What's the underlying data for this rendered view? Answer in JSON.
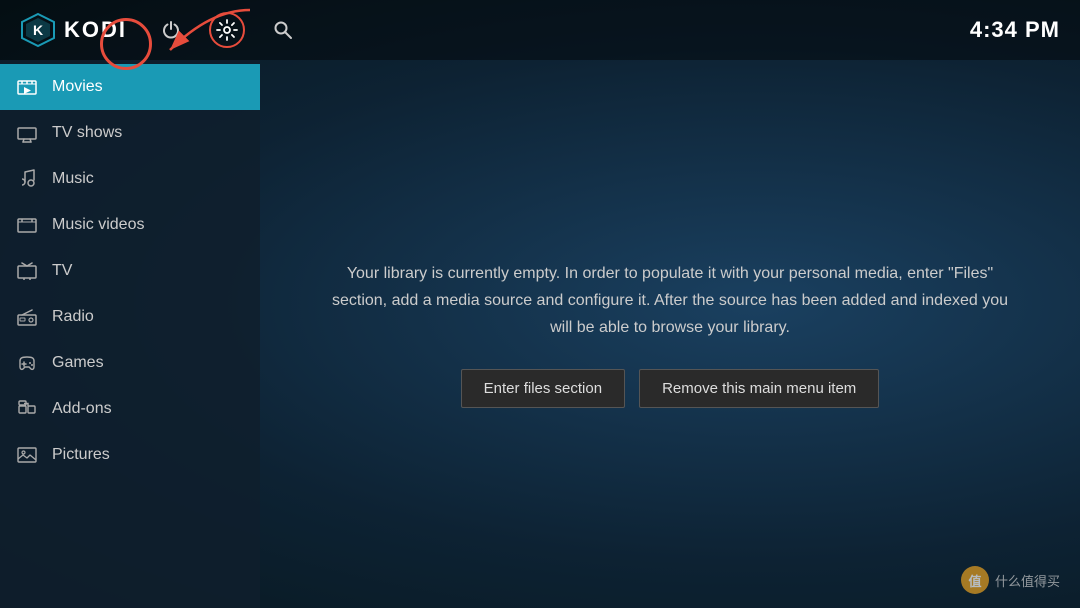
{
  "app": {
    "title": "KODI",
    "time": "4:34 PM"
  },
  "topbar": {
    "power_icon": "⏻",
    "settings_icon": "⚙",
    "search_icon": "🔍"
  },
  "sidebar": {
    "items": [
      {
        "id": "movies",
        "label": "Movies",
        "icon": "🎬",
        "active": true
      },
      {
        "id": "tvshows",
        "label": "TV shows",
        "icon": "🖥",
        "active": false
      },
      {
        "id": "music",
        "label": "Music",
        "icon": "🎧",
        "active": false
      },
      {
        "id": "musicvideos",
        "label": "Music videos",
        "icon": "🎞",
        "active": false
      },
      {
        "id": "tv",
        "label": "TV",
        "icon": "📺",
        "active": false
      },
      {
        "id": "radio",
        "label": "Radio",
        "icon": "📻",
        "active": false
      },
      {
        "id": "games",
        "label": "Games",
        "icon": "🎮",
        "active": false
      },
      {
        "id": "addons",
        "label": "Add-ons",
        "icon": "📦",
        "active": false
      },
      {
        "id": "pictures",
        "label": "Pictures",
        "icon": "🖼",
        "active": false
      }
    ]
  },
  "content": {
    "empty_message": "Your library is currently empty. In order to populate it with your personal media, enter \"Files\" section, add a media source and configure it. After the source has been added and indexed you will be able to browse your library.",
    "buttons": [
      {
        "id": "enter-files",
        "label": "Enter files section"
      },
      {
        "id": "remove-item",
        "label": "Remove this main menu item"
      }
    ]
  },
  "watermark": {
    "icon_text": "值",
    "text": "什么值得买"
  }
}
